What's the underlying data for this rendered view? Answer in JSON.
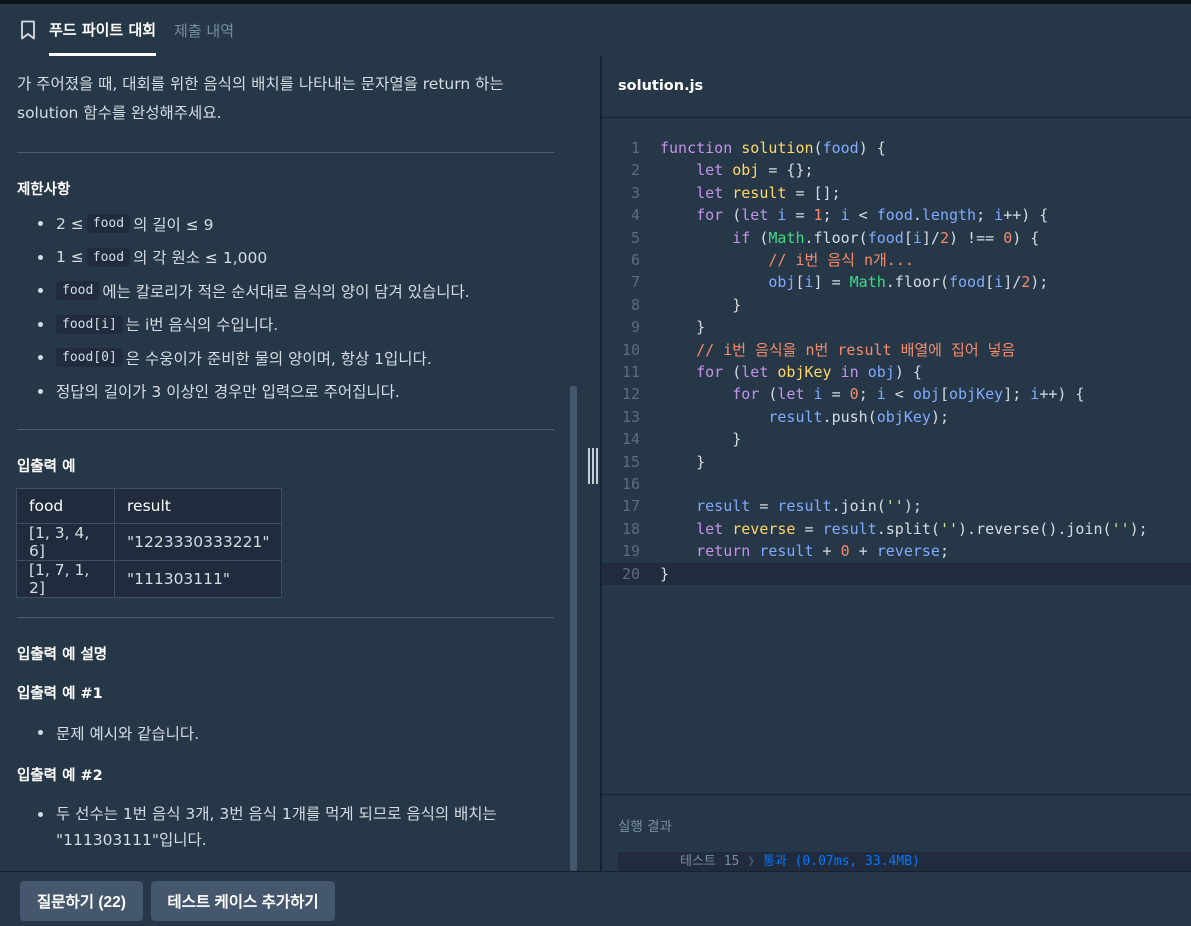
{
  "tabs": {
    "active": "푸드 파이트 대회",
    "secondary": "제출 내역"
  },
  "description": {
    "line1": "가 주어졌을 때, 대회를 위한 음식의 배치를 나타내는 문자열을 return 하는",
    "line2": "solution 함수를 완성해주세요."
  },
  "constraints": {
    "title": "제한사항",
    "items": [
      {
        "pre": "2 ≤ ",
        "code": "food",
        "post": " 의 길이 ≤ 9"
      },
      {
        "pre": "1 ≤ ",
        "code": "food",
        "post": " 의 각 원소 ≤ 1,000"
      },
      {
        "pre": "",
        "code": "food",
        "post": " 에는 칼로리가 적은 순서대로 음식의 양이 담겨 있습니다."
      },
      {
        "pre": "",
        "code": "food[i]",
        "post": " 는 i번 음식의 수입니다."
      },
      {
        "pre": "",
        "code": "food[0]",
        "post": " 은 수웅이가 준비한 물의 양이며, 항상 1입니다."
      },
      {
        "pre": "정답의 길이가 3 이상인 경우만 입력으로 주어집니다.",
        "code": "",
        "post": ""
      }
    ]
  },
  "examples": {
    "title": "입출력 예",
    "headers": [
      "food",
      "result"
    ],
    "rows": [
      [
        "[1, 3, 4, 6]",
        "\"1223330333221\""
      ],
      [
        "[1, 7, 1, 2]",
        "\"111303111\""
      ]
    ]
  },
  "explanation": {
    "title": "입출력 예 설명",
    "ex1_title": "입출력 예 #1",
    "ex1_text": "문제 예시와 같습니다.",
    "ex2_title": "입출력 예 #2",
    "ex2_line1": "두 선수는 1번 음식 3개, 3번 음식 1개를 먹게 되므로 음식의 배치는",
    "ex2_line2": "\"111303111\"입니다."
  },
  "editor": {
    "filename": "solution.js",
    "code": [
      [
        [
          "kw",
          "function "
        ],
        [
          "fn",
          "solution"
        ],
        [
          "pl",
          "("
        ],
        [
          "va",
          "food"
        ],
        [
          "pl",
          ") {"
        ]
      ],
      [
        [
          "pl",
          "    "
        ],
        [
          "kw",
          "let "
        ],
        [
          "fn",
          "obj"
        ],
        [
          "pl",
          " = {};"
        ]
      ],
      [
        [
          "pl",
          "    "
        ],
        [
          "kw",
          "let "
        ],
        [
          "fn",
          "result"
        ],
        [
          "pl",
          " = [];"
        ]
      ],
      [
        [
          "pl",
          "    "
        ],
        [
          "kw",
          "for "
        ],
        [
          "pl",
          "("
        ],
        [
          "kw",
          "let "
        ],
        [
          "va",
          "i"
        ],
        [
          "pl",
          " = "
        ],
        [
          "nu",
          "1"
        ],
        [
          "pl",
          "; "
        ],
        [
          "va",
          "i"
        ],
        [
          "pl",
          " < "
        ],
        [
          "va",
          "food"
        ],
        [
          "pl",
          "."
        ],
        [
          "va",
          "length"
        ],
        [
          "pl",
          "; "
        ],
        [
          "va",
          "i"
        ],
        [
          "pl",
          "++) {"
        ]
      ],
      [
        [
          "pl",
          "        "
        ],
        [
          "kw",
          "if "
        ],
        [
          "pl",
          "("
        ],
        [
          "cl",
          "Math"
        ],
        [
          "pl",
          ".floor("
        ],
        [
          "va",
          "food"
        ],
        [
          "pl",
          "["
        ],
        [
          "va",
          "i"
        ],
        [
          "pl",
          "]/"
        ],
        [
          "nu",
          "2"
        ],
        [
          "pl",
          ") !== "
        ],
        [
          "nu",
          "0"
        ],
        [
          "pl",
          ") {"
        ]
      ],
      [
        [
          "pl",
          "            "
        ],
        [
          "cm",
          "// i번 음식 n개..."
        ]
      ],
      [
        [
          "pl",
          "            "
        ],
        [
          "va",
          "obj"
        ],
        [
          "pl",
          "["
        ],
        [
          "va",
          "i"
        ],
        [
          "pl",
          "] = "
        ],
        [
          "cl",
          "Math"
        ],
        [
          "pl",
          ".floor("
        ],
        [
          "va",
          "food"
        ],
        [
          "pl",
          "["
        ],
        [
          "va",
          "i"
        ],
        [
          "pl",
          "]/"
        ],
        [
          "nu",
          "2"
        ],
        [
          "pl",
          ");"
        ]
      ],
      [
        [
          "pl",
          "        }"
        ]
      ],
      [
        [
          "pl",
          "    }"
        ]
      ],
      [
        [
          "pl",
          "    "
        ],
        [
          "cm",
          "// i번 음식을 n번 result 배열에 집어 넣음"
        ]
      ],
      [
        [
          "pl",
          "    "
        ],
        [
          "kw",
          "for "
        ],
        [
          "pl",
          "("
        ],
        [
          "kw",
          "let "
        ],
        [
          "fn",
          "objKey"
        ],
        [
          "kw",
          " in "
        ],
        [
          "va",
          "obj"
        ],
        [
          "pl",
          ") {"
        ]
      ],
      [
        [
          "pl",
          "        "
        ],
        [
          "kw",
          "for "
        ],
        [
          "pl",
          "("
        ],
        [
          "kw",
          "let "
        ],
        [
          "va",
          "i"
        ],
        [
          "pl",
          " = "
        ],
        [
          "nu",
          "0"
        ],
        [
          "pl",
          "; "
        ],
        [
          "va",
          "i"
        ],
        [
          "pl",
          " < "
        ],
        [
          "va",
          "obj"
        ],
        [
          "pl",
          "["
        ],
        [
          "va",
          "objKey"
        ],
        [
          "pl",
          "]; "
        ],
        [
          "va",
          "i"
        ],
        [
          "pl",
          "++) {"
        ]
      ],
      [
        [
          "pl",
          "            "
        ],
        [
          "va",
          "result"
        ],
        [
          "pl",
          ".push("
        ],
        [
          "va",
          "objKey"
        ],
        [
          "pl",
          ");"
        ]
      ],
      [
        [
          "pl",
          "        }"
        ]
      ],
      [
        [
          "pl",
          "    }"
        ]
      ],
      [
        [
          "pl",
          ""
        ]
      ],
      [
        [
          "pl",
          "    "
        ],
        [
          "va",
          "result"
        ],
        [
          "pl",
          " = "
        ],
        [
          "va",
          "result"
        ],
        [
          "pl",
          ".join("
        ],
        [
          "st",
          "''"
        ],
        [
          "pl",
          ");"
        ]
      ],
      [
        [
          "pl",
          "    "
        ],
        [
          "kw",
          "let "
        ],
        [
          "fn",
          "reverse"
        ],
        [
          "pl",
          " = "
        ],
        [
          "va",
          "result"
        ],
        [
          "pl",
          ".split("
        ],
        [
          "st",
          "''"
        ],
        [
          "pl",
          ").reverse().join("
        ],
        [
          "st",
          "''"
        ],
        [
          "pl",
          ");"
        ]
      ],
      [
        [
          "pl",
          "    "
        ],
        [
          "kw",
          "return "
        ],
        [
          "va",
          "result"
        ],
        [
          "pl",
          " + "
        ],
        [
          "nu",
          "0"
        ],
        [
          "pl",
          " + "
        ],
        [
          "va",
          "reverse"
        ],
        [
          "pl",
          ";"
        ]
      ],
      [
        [
          "pl",
          "}"
        ]
      ]
    ]
  },
  "results": {
    "title": "실행 결과",
    "test_label": "테스트 15",
    "test_status": "통과 (0.07ms, 33.4MB)"
  },
  "footer": {
    "ask_button": "질문하기 (22)",
    "add_test_button": "테스트 케이스 추가하기"
  }
}
